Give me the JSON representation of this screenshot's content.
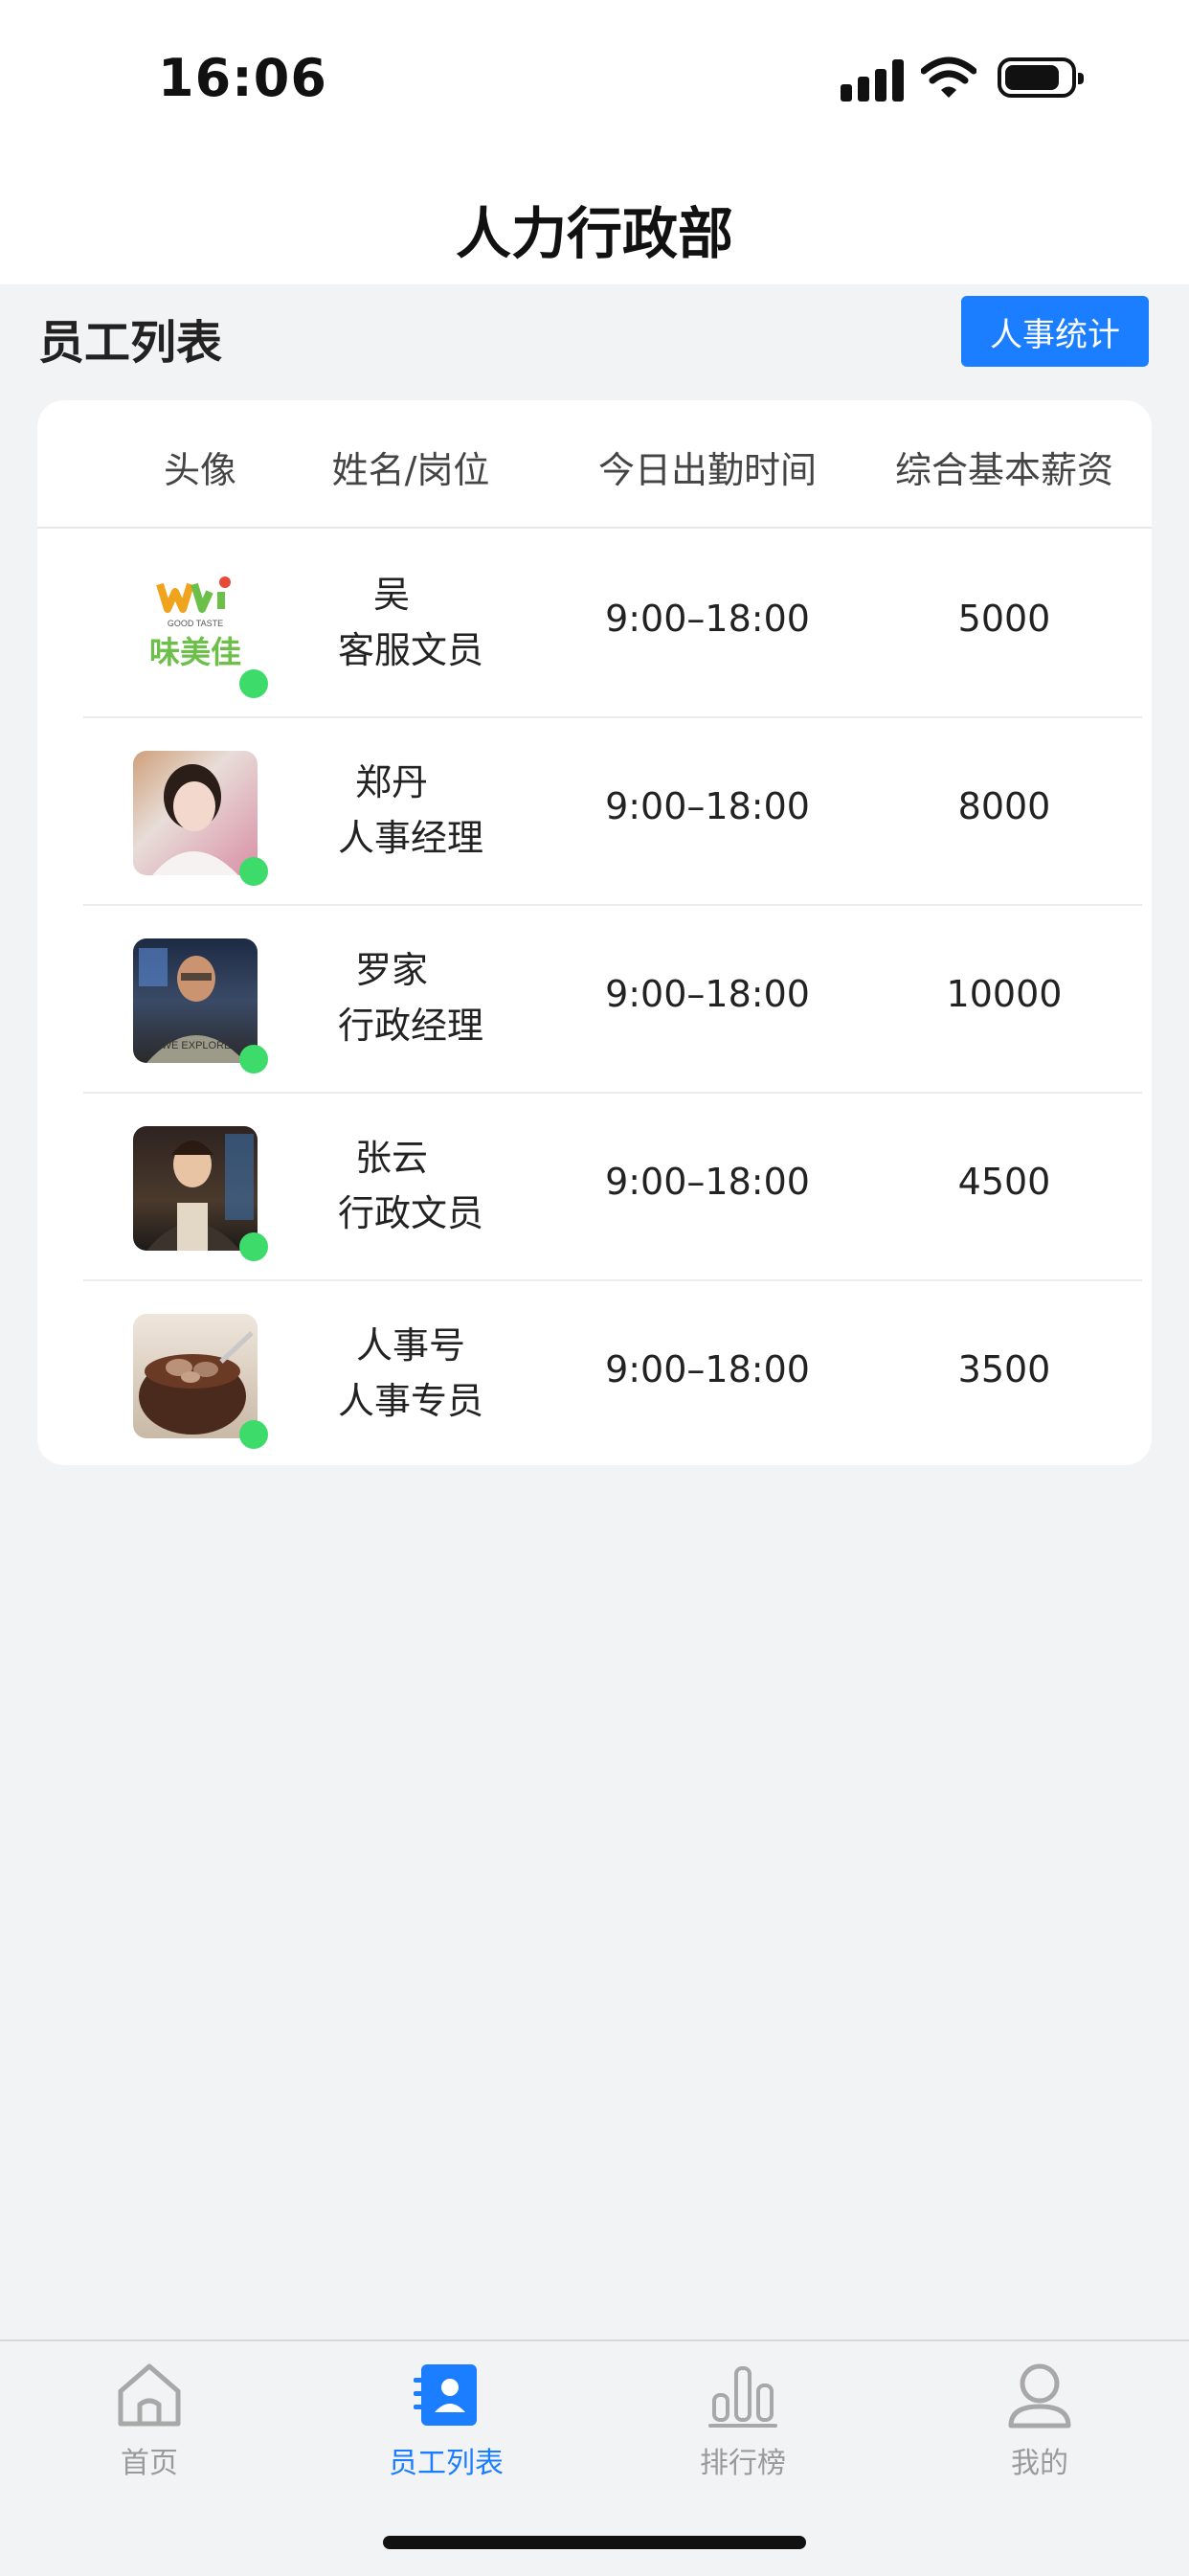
{
  "status_bar": {
    "time": "16:06"
  },
  "header": {
    "title": "人力行政部"
  },
  "section": {
    "title": "员工列表",
    "stats_button": "人事统计"
  },
  "table": {
    "columns": [
      "头像",
      "姓名/岗位",
      "今日出勤时间",
      "综合基本薪资"
    ],
    "rows": [
      {
        "name": "吴",
        "position": "客服文员",
        "attendance": "9:00–18:00",
        "salary": "5000",
        "avatar_text": "GOOD TASTE",
        "avatar_brand": "味美佳"
      },
      {
        "name": "郑丹",
        "position": "人事经理",
        "attendance": "9:00–18:00",
        "salary": "8000"
      },
      {
        "name": "罗家",
        "position": "行政经理",
        "attendance": "9:00–18:00",
        "salary": "10000",
        "avatar_text": "WE EXPLORE"
      },
      {
        "name": "张云",
        "position": "行政文员",
        "attendance": "9:00–18:00",
        "salary": "4500"
      },
      {
        "name": "人事号",
        "position": "人事专员",
        "attendance": "9:00–18:00",
        "salary": "3500"
      }
    ]
  },
  "tabbar": {
    "tabs": [
      {
        "label": "首页",
        "icon": "home-icon"
      },
      {
        "label": "员工列表",
        "icon": "contacts-icon",
        "active": true
      },
      {
        "label": "排行榜",
        "icon": "bar-chart-icon"
      },
      {
        "label": "我的",
        "icon": "user-icon"
      }
    ]
  },
  "colors": {
    "accent": "#1b7dff",
    "online": "#3ddc6a",
    "background": "#f2f3f5"
  }
}
